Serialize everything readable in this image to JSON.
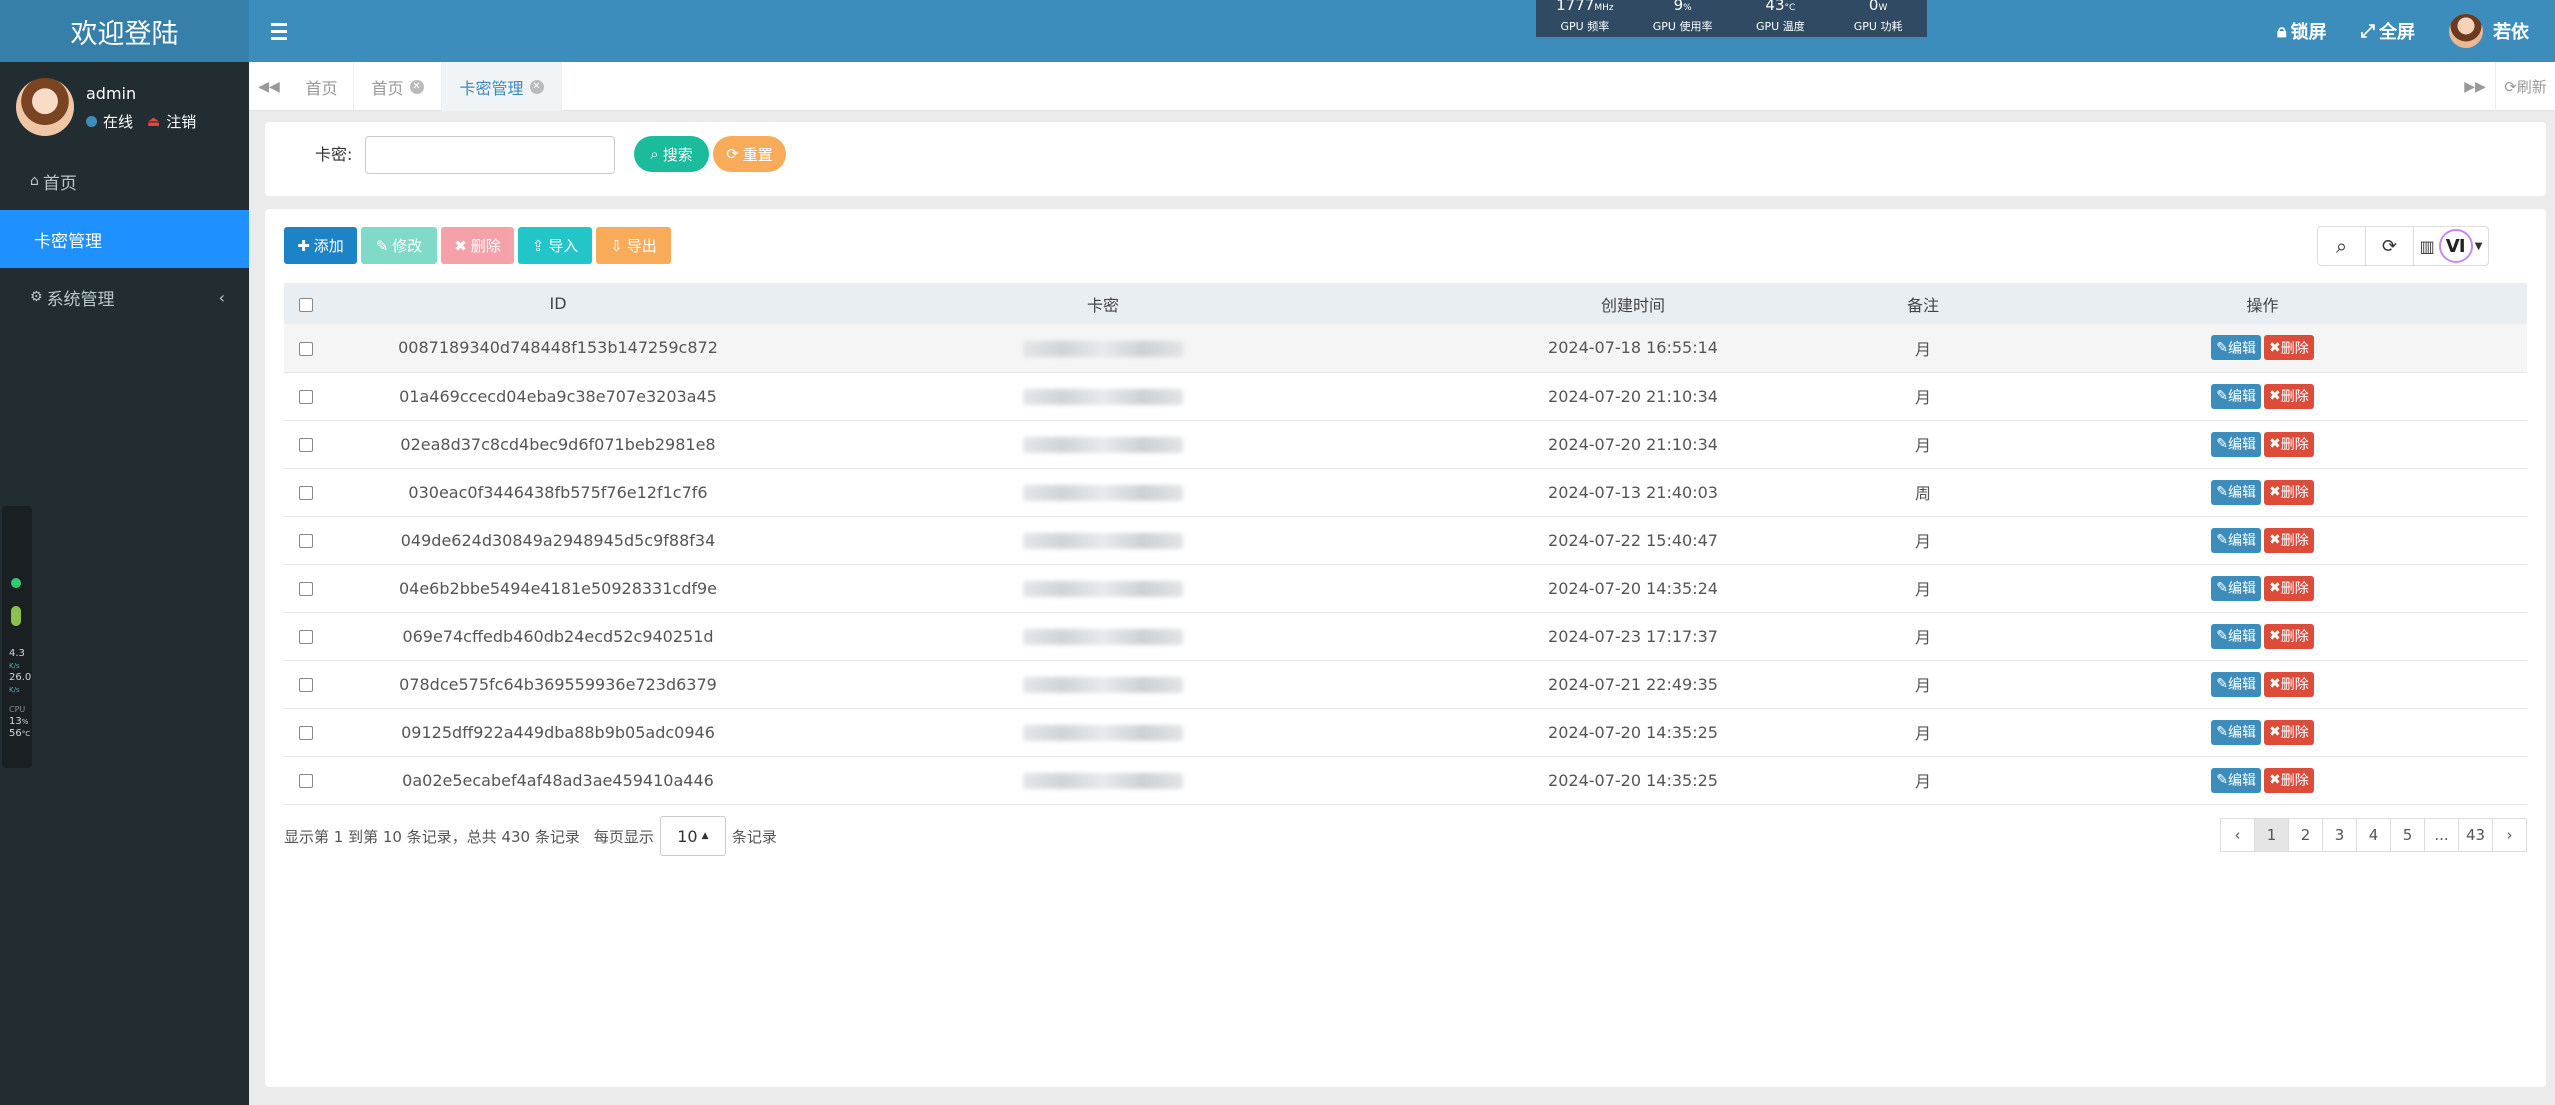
{
  "header": {
    "logo": "欢迎登陆",
    "gpu": [
      {
        "value": "1777",
        "unit": "MHz",
        "label": "GPU 频率"
      },
      {
        "value": "9",
        "unit": "%",
        "label": "GPU 使用率"
      },
      {
        "value": "43",
        "unit": "°C",
        "label": "GPU 温度"
      },
      {
        "value": "0",
        "unit": "W",
        "label": "GPU 功耗"
      }
    ],
    "lock": "锁屏",
    "fullscreen": "全屏",
    "user": "若依"
  },
  "sidebar": {
    "username": "admin",
    "status": "在线",
    "logout": "注销",
    "items": [
      {
        "label": "首页"
      },
      {
        "label": "卡密管理"
      },
      {
        "label": "系统管理"
      }
    ],
    "widget": {
      "net1": "4.3",
      "u1": "K/s",
      "net2": "26.0",
      "u2": "K/s",
      "cpu_label": "CPU",
      "cpu": "13",
      "pct": "%",
      "temp": "56",
      "temp_unit": "°C"
    }
  },
  "tabs": {
    "items": [
      {
        "label": "首页"
      },
      {
        "label": "首页"
      },
      {
        "label": "卡密管理"
      }
    ],
    "refresh": "刷新"
  },
  "search": {
    "label": "卡密:",
    "value": "",
    "search_btn": "搜索",
    "reset_btn": "重置"
  },
  "toolbar": {
    "add": "添加",
    "edit": "修改",
    "delete": "删除",
    "import": "导入",
    "export": "导出"
  },
  "table": {
    "columns": [
      "ID",
      "卡密",
      "创建时间",
      "备注",
      "操作"
    ],
    "edit_label": "编辑",
    "delete_label": "删除",
    "rows": [
      {
        "id": "0087189340d748448f153b147259c872",
        "time": "2024-07-18 16:55:14",
        "note": "月"
      },
      {
        "id": "01a469ccecd04eba9c38e707e3203a45",
        "time": "2024-07-20 21:10:34",
        "note": "月"
      },
      {
        "id": "02ea8d37c8cd4bec9d6f071beb2981e8",
        "time": "2024-07-20 21:10:34",
        "note": "月"
      },
      {
        "id": "030eac0f3446438fb575f76e12f1c7f6",
        "time": "2024-07-13 21:40:03",
        "note": "周"
      },
      {
        "id": "049de624d30849a2948945d5c9f88f34",
        "time": "2024-07-22 15:40:47",
        "note": "月"
      },
      {
        "id": "04e6b2bbe5494e4181e50928331cdf9e",
        "time": "2024-07-20 14:35:24",
        "note": "月"
      },
      {
        "id": "069e74cffedb460db24ecd52c940251d",
        "time": "2024-07-23 17:17:37",
        "note": "月"
      },
      {
        "id": "078dce575fc64b369559936e723d6379",
        "time": "2024-07-21 22:49:35",
        "note": "月"
      },
      {
        "id": "09125dff922a449dba88b9b05adc0946",
        "time": "2024-07-20 14:35:25",
        "note": "月"
      },
      {
        "id": "0a02e5ecabef4af48ad3ae459410a446",
        "time": "2024-07-20 14:35:25",
        "note": "月"
      }
    ]
  },
  "footer": {
    "summary": "显示第 1 到第 10 条记录，总共 430 条记录",
    "per_page_label": "每页显示",
    "per_page": "10",
    "suffix": "条记录"
  },
  "pagination": [
    "‹",
    "1",
    "2",
    "3",
    "4",
    "5",
    "...",
    "43",
    "›"
  ],
  "colors": {
    "header": "#3c8dbc",
    "sidebar": "#222d32",
    "active": "#1e90ff",
    "search_btn": "#1abc9c",
    "reset_btn": "#f8ac59"
  }
}
